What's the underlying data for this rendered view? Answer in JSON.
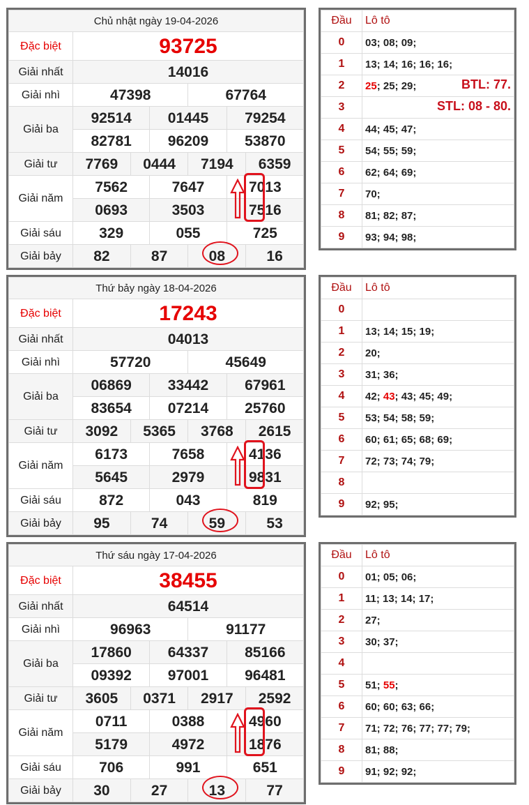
{
  "draws": [
    {
      "title": "Chủ nhật ngày 19-04-2026",
      "labels": [
        "Đặc biệt",
        "Giải nhất",
        "Giải nhì",
        "Giải ba",
        "Giải tư",
        "Giải năm",
        "Giải sáu",
        "Giải bảy"
      ],
      "special": "93725",
      "first": "14016",
      "second": [
        "47398",
        "67764"
      ],
      "third": [
        "92514",
        "01445",
        "79254",
        "82781",
        "96209",
        "53870"
      ],
      "fourth": [
        "7769",
        "0444",
        "7194",
        "6359"
      ],
      "fifth": [
        "7562",
        "7647",
        "7013",
        "0693",
        "3503",
        "7516"
      ],
      "sixth": [
        "329",
        "055",
        "725"
      ],
      "seventh": [
        "82",
        "87",
        "08",
        "16"
      ],
      "loto_header": [
        "Đầu",
        "Lô tô"
      ],
      "loto": [
        {
          "head": "0",
          "parts": [
            {
              "t": "03; 08; 09;"
            }
          ]
        },
        {
          "head": "1",
          "parts": [
            {
              "t": "13; 14; 16; 16; 16;"
            }
          ]
        },
        {
          "head": "2",
          "parts": [
            {
              "t": "25",
              "hl": true
            },
            {
              "t": "; 25; 29;"
            }
          ],
          "note": "BTL: 77."
        },
        {
          "head": "3",
          "parts": [],
          "note": "STL: 08 - 80."
        },
        {
          "head": "4",
          "parts": [
            {
              "t": "44; 45; 47;"
            }
          ]
        },
        {
          "head": "5",
          "parts": [
            {
              "t": "54; 55; 59;"
            }
          ]
        },
        {
          "head": "6",
          "parts": [
            {
              "t": "62; 64; 69;"
            }
          ]
        },
        {
          "head": "7",
          "parts": [
            {
              "t": "70;"
            }
          ]
        },
        {
          "head": "8",
          "parts": [
            {
              "t": "81; 82; 87;"
            }
          ]
        },
        {
          "head": "9",
          "parts": [
            {
              "t": "93; 94; 98;"
            }
          ]
        }
      ]
    },
    {
      "title": "Thứ bảy ngày 18-04-2026",
      "labels": [
        "Đặc biệt",
        "Giải nhất",
        "Giải nhì",
        "Giải ba",
        "Giải tư",
        "Giải năm",
        "Giải sáu",
        "Giải bảy"
      ],
      "special": "17243",
      "first": "04013",
      "second": [
        "57720",
        "45649"
      ],
      "third": [
        "06869",
        "33442",
        "67961",
        "83654",
        "07214",
        "25760"
      ],
      "fourth": [
        "3092",
        "5365",
        "3768",
        "2615"
      ],
      "fifth": [
        "6173",
        "7658",
        "4136",
        "5645",
        "2979",
        "9831"
      ],
      "sixth": [
        "872",
        "043",
        "819"
      ],
      "seventh": [
        "95",
        "74",
        "59",
        "53"
      ],
      "loto_header": [
        "Đầu",
        "Lô tô"
      ],
      "loto": [
        {
          "head": "0",
          "parts": []
        },
        {
          "head": "1",
          "parts": [
            {
              "t": "13; 14; 15; 19;"
            }
          ]
        },
        {
          "head": "2",
          "parts": [
            {
              "t": "20;"
            }
          ]
        },
        {
          "head": "3",
          "parts": [
            {
              "t": "31; 36;"
            }
          ]
        },
        {
          "head": "4",
          "parts": [
            {
              "t": "42; "
            },
            {
              "t": "43",
              "hl": true
            },
            {
              "t": "; 43; 45; 49;"
            }
          ]
        },
        {
          "head": "5",
          "parts": [
            {
              "t": "53; 54; 58; 59;"
            }
          ]
        },
        {
          "head": "6",
          "parts": [
            {
              "t": "60; 61; 65; 68; 69;"
            }
          ]
        },
        {
          "head": "7",
          "parts": [
            {
              "t": "72; 73; 74; 79;"
            }
          ]
        },
        {
          "head": "8",
          "parts": []
        },
        {
          "head": "9",
          "parts": [
            {
              "t": "92; 95;"
            }
          ]
        }
      ]
    },
    {
      "title": "Thứ sáu ngày 17-04-2026",
      "labels": [
        "Đặc biệt",
        "Giải nhất",
        "Giải nhì",
        "Giải ba",
        "Giải tư",
        "Giải năm",
        "Giải sáu",
        "Giải bảy"
      ],
      "special": "38455",
      "first": "64514",
      "second": [
        "96963",
        "91177"
      ],
      "third": [
        "17860",
        "64337",
        "85166",
        "09392",
        "97001",
        "96481"
      ],
      "fourth": [
        "3605",
        "0371",
        "2917",
        "2592"
      ],
      "fifth": [
        "0711",
        "0388",
        "4960",
        "5179",
        "4972",
        "1876"
      ],
      "sixth": [
        "706",
        "991",
        "651"
      ],
      "seventh": [
        "30",
        "27",
        "13",
        "77"
      ],
      "loto_header": [
        "Đầu",
        "Lô tô"
      ],
      "loto": [
        {
          "head": "0",
          "parts": [
            {
              "t": "01; 05; 06;"
            }
          ]
        },
        {
          "head": "1",
          "parts": [
            {
              "t": "11; 13; 14; 17;"
            }
          ]
        },
        {
          "head": "2",
          "parts": [
            {
              "t": "27;"
            }
          ]
        },
        {
          "head": "3",
          "parts": [
            {
              "t": "30; 37;"
            }
          ]
        },
        {
          "head": "4",
          "parts": []
        },
        {
          "head": "5",
          "parts": [
            {
              "t": "51; "
            },
            {
              "t": "55",
              "hl": true
            },
            {
              "t": ";"
            }
          ]
        },
        {
          "head": "6",
          "parts": [
            {
              "t": "60; 60; 63; 66;"
            }
          ]
        },
        {
          "head": "7",
          "parts": [
            {
              "t": "71; 72; 76; 77; 77; 79;"
            }
          ]
        },
        {
          "head": "8",
          "parts": [
            {
              "t": "81; 88;"
            }
          ]
        },
        {
          "head": "9",
          "parts": [
            {
              "t": "91; 92; 92;"
            }
          ]
        }
      ]
    }
  ]
}
